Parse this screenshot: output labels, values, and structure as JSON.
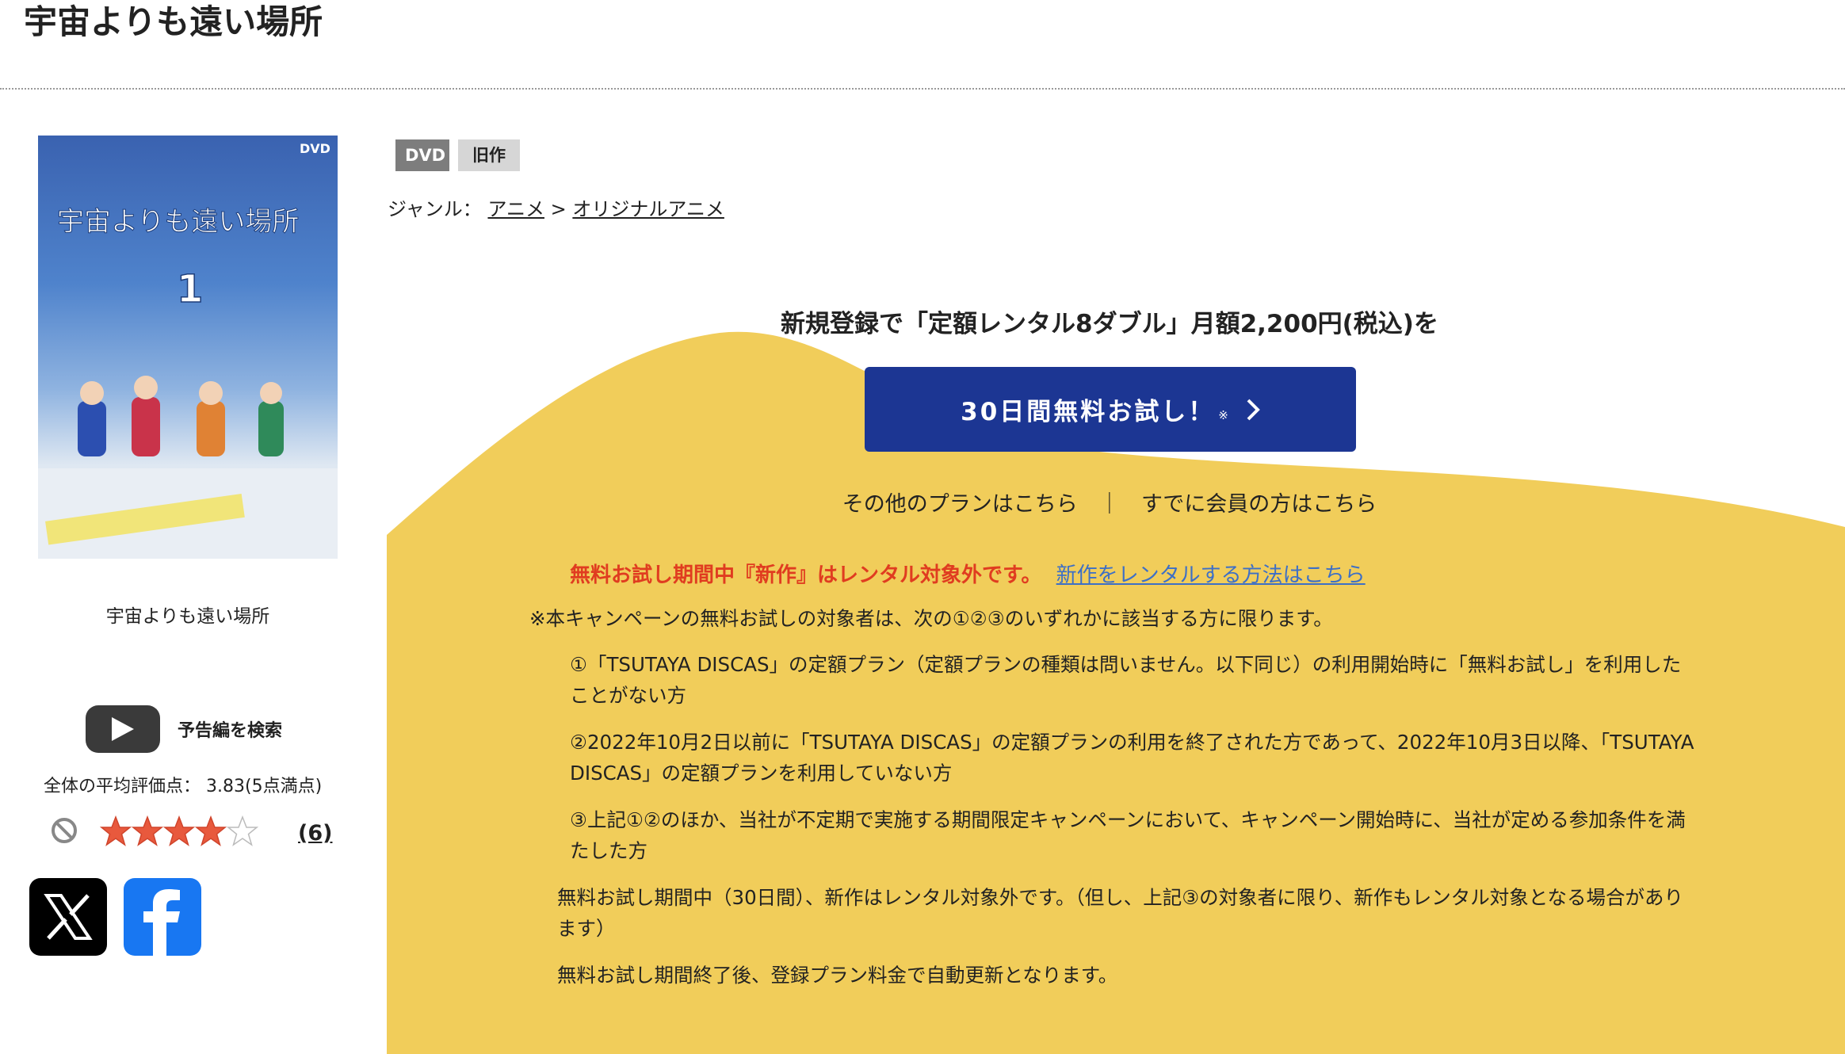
{
  "page": {
    "title": "宇宙よりも遠い場所"
  },
  "product": {
    "cover_alt": "宇宙よりも遠い場所",
    "caption": "宇宙よりも遠い場所",
    "trailer_label": "予告編を検索",
    "rating_label": "全体の平均評価点：",
    "rating_value": "3.83(5点満点)",
    "stars": 3.83,
    "review_count": "(6)",
    "badges": [
      "DVD",
      "旧作"
    ]
  },
  "genre": {
    "label": "ジャンル：",
    "items": [
      "アニメ",
      "オリジナルアニメ"
    ],
    "separator": ">"
  },
  "promo": {
    "headline": "新規登録で「定額レンタル8ダブル」月額2,200円(税込)を",
    "button_label": "30日間無料お試し！",
    "button_note": "※",
    "other_plans": "その他のプランはこちら",
    "divider": "｜",
    "members": "すでに会員の方はこちら",
    "warning": "無料お試し期間中『新作』はレンタル対象外です。",
    "warning_link": "新作をレンタルする方法はこちら",
    "eligibility": "※本キャンペーンの無料お試しの対象者は、次の①②③のいずれかに該当する方に限ります。",
    "conditions": [
      "①「TSUTAYA DISCAS」の定額プラン（定額プランの種類は問いません。以下同じ）の利用開始時に「無料お試し」を利用したことがない方",
      "②2022年10月2日以前に「TSUTAYA DISCAS」の定額プランの利用を終了された方であって、2022年10月3日以降、「TSUTAYA DISCAS」の定額プランを利用していない方",
      "③上記①②のほか、当社が不定期で実施する期間限定キャンペーンにおいて、キャンペーン開始時に、当社が定める参加条件を満たした方"
    ],
    "note1": "無料お試し期間中（30日間）、新作はレンタル対象外です。（但し、上記③の対象者に限り、新作もレンタル対象となる場合があります）",
    "note2": "無料お試し期間終了後、登録プラン料金で自動更新となります。"
  },
  "colors": {
    "promo_yellow": "#f1cd5a",
    "button_blue": "#1c3693",
    "warning_red": "#e03c20",
    "link_blue": "#3d6fc6",
    "star_orange": "#e8593d",
    "facebook_blue": "#1877f2"
  }
}
